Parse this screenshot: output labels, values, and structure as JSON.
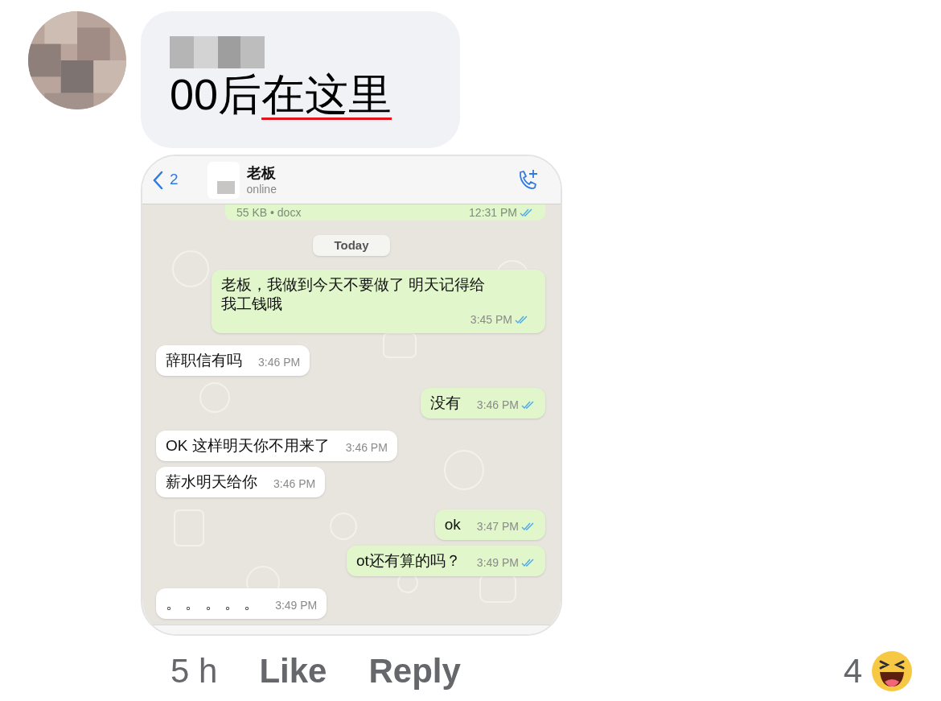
{
  "comment": {
    "text_parts": [
      {
        "text": "00后",
        "underlined": false
      },
      {
        "text": "在这里",
        "underlined": true
      }
    ]
  },
  "chat_screenshot": {
    "header": {
      "back_count": "2",
      "contact_name": "老板",
      "status": "online"
    },
    "partial_message": {
      "file_info": "55 KB • docx",
      "time": "12:31 PM",
      "read": true
    },
    "date_chip": "Today",
    "messages": [
      {
        "kind": "outgoing",
        "text": "老板，我做到今天不要做了 明天记得给我工钱哦",
        "time": "3:45 PM",
        "read": true
      },
      {
        "kind": "incoming",
        "text": "辞职信有吗",
        "time": "3:46 PM"
      },
      {
        "kind": "outgoing",
        "text": "没有",
        "time": "3:46 PM",
        "read": true
      },
      {
        "kind": "incoming",
        "text": "OK 这样明天你不用来了",
        "time": "3:46 PM"
      },
      {
        "kind": "incoming",
        "text": "薪水明天给你",
        "time": "3:46 PM"
      },
      {
        "kind": "outgoing",
        "text": "ok",
        "time": "3:47 PM",
        "read": true
      },
      {
        "kind": "outgoing",
        "text": "ot还有算的吗？",
        "time": "3:49 PM",
        "read": true
      },
      {
        "kind": "incoming",
        "text": "。 。 。 。 。",
        "time": "3:49 PM"
      }
    ]
  },
  "footer": {
    "age": "5 h",
    "like": "Like",
    "reply": "Reply",
    "reaction_count": "4"
  }
}
